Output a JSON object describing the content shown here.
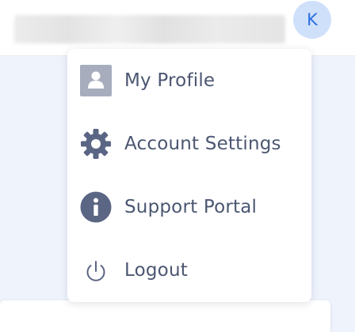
{
  "header": {
    "avatar_initial": "K"
  },
  "menu": {
    "items": [
      {
        "label": "My Profile",
        "icon": "profile-icon"
      },
      {
        "label": "Account Settings",
        "icon": "gear-icon"
      },
      {
        "label": "Support Portal",
        "icon": "info-icon"
      },
      {
        "label": "Logout",
        "icon": "power-icon"
      }
    ]
  },
  "colors": {
    "page_background": "#eef3fc",
    "menu_text": "#4b5671",
    "icon": "#5b6584",
    "avatar_bg": "#cfe0fb",
    "avatar_text": "#2a6fe0"
  }
}
